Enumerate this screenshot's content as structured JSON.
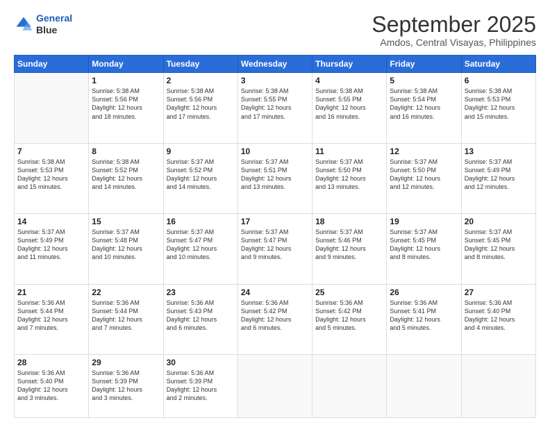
{
  "header": {
    "logo_line1": "General",
    "logo_line2": "Blue",
    "month": "September 2025",
    "location": "Amdos, Central Visayas, Philippines"
  },
  "weekdays": [
    "Sunday",
    "Monday",
    "Tuesday",
    "Wednesday",
    "Thursday",
    "Friday",
    "Saturday"
  ],
  "weeks": [
    [
      {
        "day": "",
        "info": ""
      },
      {
        "day": "1",
        "info": "Sunrise: 5:38 AM\nSunset: 5:56 PM\nDaylight: 12 hours\nand 18 minutes."
      },
      {
        "day": "2",
        "info": "Sunrise: 5:38 AM\nSunset: 5:56 PM\nDaylight: 12 hours\nand 17 minutes."
      },
      {
        "day": "3",
        "info": "Sunrise: 5:38 AM\nSunset: 5:55 PM\nDaylight: 12 hours\nand 17 minutes."
      },
      {
        "day": "4",
        "info": "Sunrise: 5:38 AM\nSunset: 5:55 PM\nDaylight: 12 hours\nand 16 minutes."
      },
      {
        "day": "5",
        "info": "Sunrise: 5:38 AM\nSunset: 5:54 PM\nDaylight: 12 hours\nand 16 minutes."
      },
      {
        "day": "6",
        "info": "Sunrise: 5:38 AM\nSunset: 5:53 PM\nDaylight: 12 hours\nand 15 minutes."
      }
    ],
    [
      {
        "day": "7",
        "info": "Sunrise: 5:38 AM\nSunset: 5:53 PM\nDaylight: 12 hours\nand 15 minutes."
      },
      {
        "day": "8",
        "info": "Sunrise: 5:38 AM\nSunset: 5:52 PM\nDaylight: 12 hours\nand 14 minutes."
      },
      {
        "day": "9",
        "info": "Sunrise: 5:37 AM\nSunset: 5:52 PM\nDaylight: 12 hours\nand 14 minutes."
      },
      {
        "day": "10",
        "info": "Sunrise: 5:37 AM\nSunset: 5:51 PM\nDaylight: 12 hours\nand 13 minutes."
      },
      {
        "day": "11",
        "info": "Sunrise: 5:37 AM\nSunset: 5:50 PM\nDaylight: 12 hours\nand 13 minutes."
      },
      {
        "day": "12",
        "info": "Sunrise: 5:37 AM\nSunset: 5:50 PM\nDaylight: 12 hours\nand 12 minutes."
      },
      {
        "day": "13",
        "info": "Sunrise: 5:37 AM\nSunset: 5:49 PM\nDaylight: 12 hours\nand 12 minutes."
      }
    ],
    [
      {
        "day": "14",
        "info": "Sunrise: 5:37 AM\nSunset: 5:49 PM\nDaylight: 12 hours\nand 11 minutes."
      },
      {
        "day": "15",
        "info": "Sunrise: 5:37 AM\nSunset: 5:48 PM\nDaylight: 12 hours\nand 10 minutes."
      },
      {
        "day": "16",
        "info": "Sunrise: 5:37 AM\nSunset: 5:47 PM\nDaylight: 12 hours\nand 10 minutes."
      },
      {
        "day": "17",
        "info": "Sunrise: 5:37 AM\nSunset: 5:47 PM\nDaylight: 12 hours\nand 9 minutes."
      },
      {
        "day": "18",
        "info": "Sunrise: 5:37 AM\nSunset: 5:46 PM\nDaylight: 12 hours\nand 9 minutes."
      },
      {
        "day": "19",
        "info": "Sunrise: 5:37 AM\nSunset: 5:45 PM\nDaylight: 12 hours\nand 8 minutes."
      },
      {
        "day": "20",
        "info": "Sunrise: 5:37 AM\nSunset: 5:45 PM\nDaylight: 12 hours\nand 8 minutes."
      }
    ],
    [
      {
        "day": "21",
        "info": "Sunrise: 5:36 AM\nSunset: 5:44 PM\nDaylight: 12 hours\nand 7 minutes."
      },
      {
        "day": "22",
        "info": "Sunrise: 5:36 AM\nSunset: 5:44 PM\nDaylight: 12 hours\nand 7 minutes."
      },
      {
        "day": "23",
        "info": "Sunrise: 5:36 AM\nSunset: 5:43 PM\nDaylight: 12 hours\nand 6 minutes."
      },
      {
        "day": "24",
        "info": "Sunrise: 5:36 AM\nSunset: 5:42 PM\nDaylight: 12 hours\nand 6 minutes."
      },
      {
        "day": "25",
        "info": "Sunrise: 5:36 AM\nSunset: 5:42 PM\nDaylight: 12 hours\nand 5 minutes."
      },
      {
        "day": "26",
        "info": "Sunrise: 5:36 AM\nSunset: 5:41 PM\nDaylight: 12 hours\nand 5 minutes."
      },
      {
        "day": "27",
        "info": "Sunrise: 5:36 AM\nSunset: 5:40 PM\nDaylight: 12 hours\nand 4 minutes."
      }
    ],
    [
      {
        "day": "28",
        "info": "Sunrise: 5:36 AM\nSunset: 5:40 PM\nDaylight: 12 hours\nand 3 minutes."
      },
      {
        "day": "29",
        "info": "Sunrise: 5:36 AM\nSunset: 5:39 PM\nDaylight: 12 hours\nand 3 minutes."
      },
      {
        "day": "30",
        "info": "Sunrise: 5:36 AM\nSunset: 5:39 PM\nDaylight: 12 hours\nand 2 minutes."
      },
      {
        "day": "",
        "info": ""
      },
      {
        "day": "",
        "info": ""
      },
      {
        "day": "",
        "info": ""
      },
      {
        "day": "",
        "info": ""
      }
    ]
  ]
}
